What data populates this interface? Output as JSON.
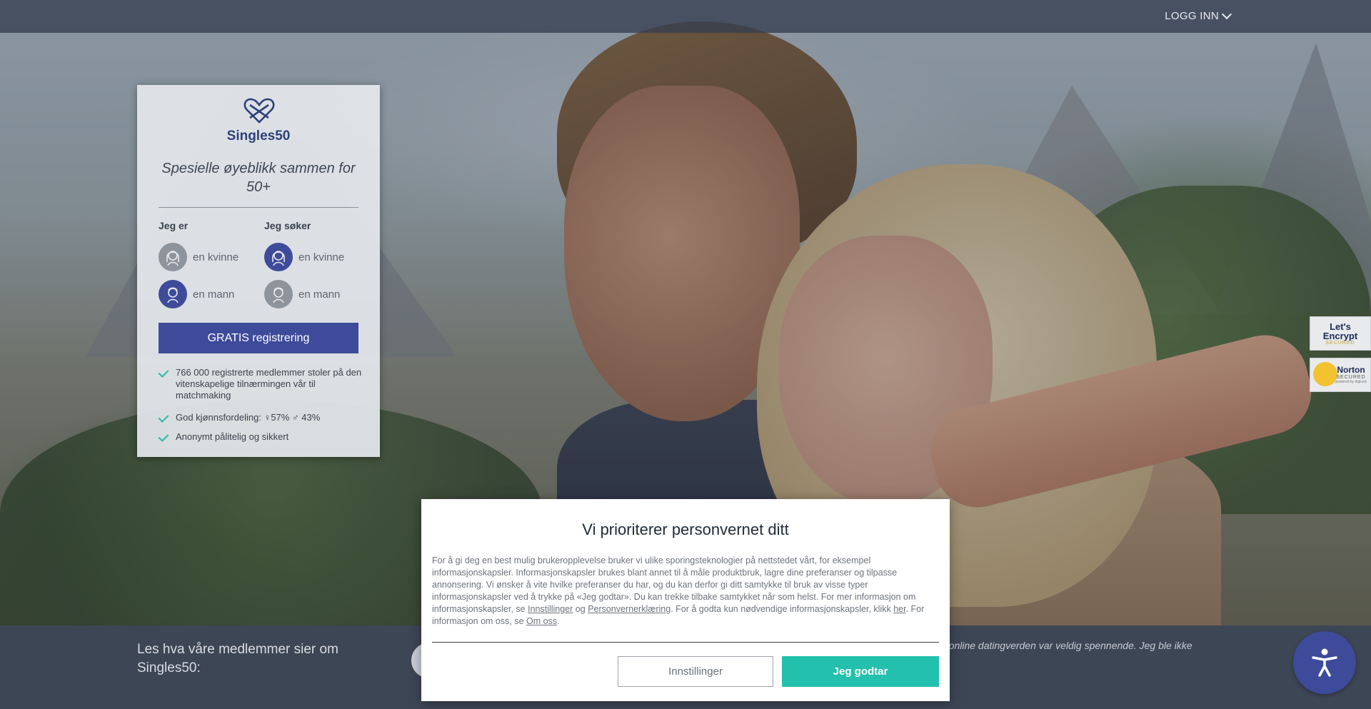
{
  "nav": {
    "login_label": "LOGG INN"
  },
  "brand": {
    "name": "Singles50",
    "tagline": "Spesielle øyeblikk sammen for 50+"
  },
  "form": {
    "i_am_label": "Jeg er",
    "seeking_label": "Jeg søker",
    "i_am_options": [
      {
        "label": "en kvinne",
        "selected": false
      },
      {
        "label": "en mann",
        "selected": true
      }
    ],
    "seeking_options": [
      {
        "label": "en kvinne",
        "selected": true
      },
      {
        "label": "en mann",
        "selected": false
      }
    ],
    "register_button": "GRATIS registrering"
  },
  "features": [
    "766 000 registrerte medlemmer stoler på den vitenskapelige tilnærmingen vår til matchmaking",
    "God kjønnsfordeling: ♀57% ♂ 43%",
    "Anonymt pålitelig og sikkert"
  ],
  "badges": {
    "letsencrypt_line1": "Let's",
    "letsencrypt_line2": "Encrypt",
    "letsencrypt_line3": "SECURED",
    "norton_line1": "Norton",
    "norton_line2": "SECURED",
    "norton_line3": "powered by digicert"
  },
  "footer": {
    "lead": "Les hva våre medlemmer sier om Singles50:",
    "quote": "tt i online datingverden var veldig spennende. Jeg ble ikke"
  },
  "cookie": {
    "title": "Vi prioriterer personvernet ditt",
    "text_1": "For å gi deg en best mulig brukeropplevelse bruker vi ulike sporingsteknologier på nettstedet vårt, for eksempel informasjonskapsler. Informasjonskapsler brukes blant annet til å måle produktbruk, lagre dine preferanser og tilpasse annonsering. Vi ønsker å vite hvilke preferanser du har, og du kan derfor gi ditt samtykke til bruk av visse typer informasjonskapsler ved å trykke på «Jeg godtar». Du kan trekke tilbake samtykket når som helst. For mer informasjon om informasjonskapsler, se ",
    "link_settings": "Innstillinger",
    "text_og": " og ",
    "link_privacy": "Personvernerklæring",
    "text_2": ". For å godta kun nødvendige informasjonskapsler, klikk ",
    "link_here": "her",
    "text_3": ". For informasjon om oss, se ",
    "link_about": "Om oss",
    "text_4": ".",
    "settings_button": "Innstillinger",
    "accept_button": "Jeg godtar"
  },
  "colors": {
    "brand_blue": "#3e4b9a",
    "accent_teal": "#22c0ad",
    "check_teal": "#2bb6a3"
  },
  "icons": [
    "chevron-down-icon",
    "heart-infinity-logo",
    "woman-avatar-icon",
    "man-avatar-icon",
    "checkmark-icon",
    "accessibility-icon"
  ]
}
